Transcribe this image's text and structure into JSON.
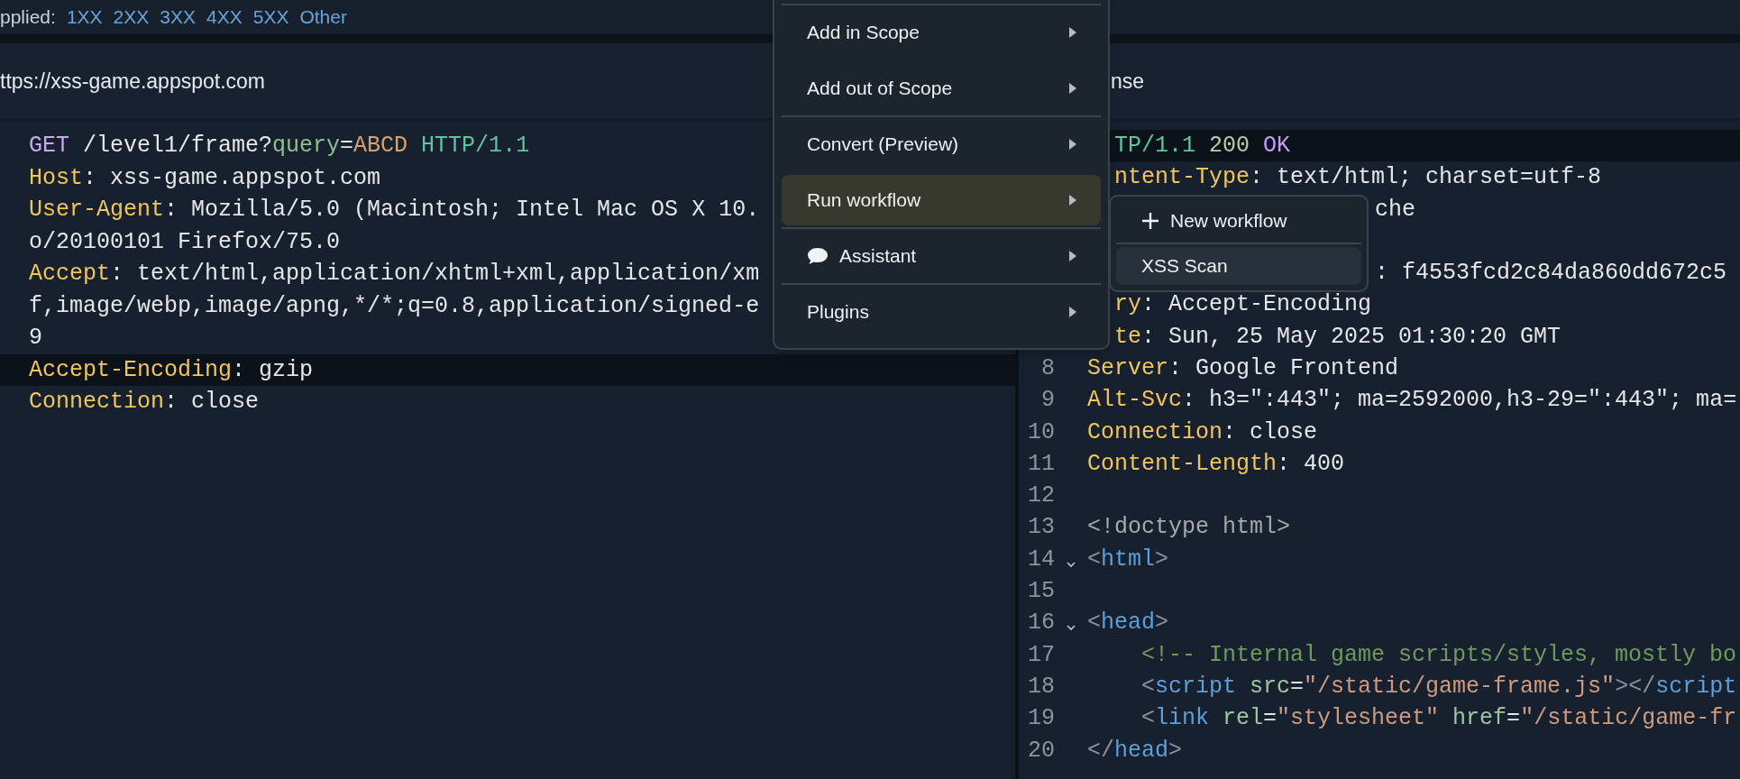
{
  "filter_bar": {
    "label": "pplied:",
    "options": [
      {
        "label": "1XX"
      },
      {
        "label": "2XX"
      },
      {
        "label": "3XX"
      },
      {
        "label": "4XX"
      },
      {
        "label": "5XX"
      },
      {
        "label": "Other"
      }
    ]
  },
  "request": {
    "title": "ttps://xss-game.appspot.com",
    "lines": [
      {
        "highlighted": false,
        "tokens": [
          {
            "text": "GET",
            "kind": "method"
          },
          {
            "text": " /level1/frame?",
            "kind": "plain"
          },
          {
            "text": "query",
            "kind": "param"
          },
          {
            "text": "=",
            "kind": "plain"
          },
          {
            "text": "ABCD",
            "kind": "value"
          },
          {
            "text": " HTTP/1.1",
            "kind": "version"
          }
        ]
      },
      {
        "highlighted": false,
        "tokens": [
          {
            "text": "Host",
            "kind": "key"
          },
          {
            "text": ": xss-game.appspot.com",
            "kind": "plain"
          }
        ]
      },
      {
        "highlighted": false,
        "tokens": [
          {
            "text": "User-Agent",
            "kind": "key"
          },
          {
            "text": ": Mozilla/5.0 (Macintosh; Intel Mac OS X 10.",
            "kind": "plain"
          }
        ]
      },
      {
        "highlighted": false,
        "tokens": [
          {
            "text": "o/20100101 Firefox/75.0",
            "kind": "plain"
          }
        ]
      },
      {
        "highlighted": false,
        "tokens": [
          {
            "text": "Accept",
            "kind": "key"
          },
          {
            "text": ": text/html,application/xhtml+xml,application/xm",
            "kind": "plain"
          }
        ]
      },
      {
        "highlighted": false,
        "tokens": [
          {
            "text": "f,image/webp,image/apng,*/*;q=0.8,application/signed-e",
            "kind": "plain"
          }
        ]
      },
      {
        "highlighted": false,
        "tokens": [
          {
            "text": "9",
            "kind": "plain"
          }
        ]
      },
      {
        "highlighted": true,
        "tokens": [
          {
            "text": "Accept-Encoding",
            "kind": "key"
          },
          {
            "text": ": gzip",
            "kind": "plain"
          }
        ]
      },
      {
        "highlighted": false,
        "tokens": [
          {
            "text": "Connection",
            "kind": "key"
          },
          {
            "text": ": close",
            "kind": "plain"
          }
        ]
      }
    ]
  },
  "response": {
    "title": "nse",
    "lines": [
      {
        "kind": "after_menu",
        "highlighted": true,
        "tokens": [
          {
            "text": "TP/1.1",
            "kind": "version"
          },
          {
            "text": " 200",
            "kind": "status"
          },
          {
            "text": " OK",
            "kind": "reason"
          }
        ]
      },
      {
        "kind": "after_menu",
        "highlighted": false,
        "tokens": [
          {
            "text": "ntent-Type",
            "kind": "key"
          },
          {
            "text": ": text/html; charset=utf-8",
            "kind": "plain"
          }
        ]
      },
      {
        "kind": "after_submenu",
        "highlighted": false,
        "tokens": [
          {
            "text": "che",
            "kind": "plain"
          }
        ]
      },
      {
        "kind": "covered",
        "highlighted": false
      },
      {
        "kind": "after_submenu",
        "highlighted": false,
        "tokens": [
          {
            "text": ": f4553fcd2c84da860dd672c5",
            "kind": "plain"
          }
        ]
      },
      {
        "kind": "after_menu",
        "highlighted": false,
        "tokens": [
          {
            "text": "ry",
            "kind": "key"
          },
          {
            "text": ": Accept-Encoding",
            "kind": "plain"
          }
        ]
      },
      {
        "kind": "after_menu",
        "highlighted": false,
        "tokens": [
          {
            "text": "te",
            "kind": "key"
          },
          {
            "text": ": Sun, 25 May 2025 01:30:20 GMT",
            "kind": "plain"
          }
        ]
      },
      {
        "kind": "full",
        "number": "8",
        "highlighted": false,
        "tokens": [
          {
            "text": "Server",
            "kind": "key"
          },
          {
            "text": ": Google Frontend",
            "kind": "plain"
          }
        ]
      },
      {
        "kind": "full",
        "number": "9",
        "highlighted": false,
        "tokens": [
          {
            "text": "Alt-Svc",
            "kind": "key"
          },
          {
            "text": ": h3=\":443\"; ma=2592000,h3-29=\":443\"; ma=",
            "kind": "plain"
          }
        ]
      },
      {
        "kind": "full",
        "number": "10",
        "highlighted": false,
        "tokens": [
          {
            "text": "Connection",
            "kind": "key"
          },
          {
            "text": ": close",
            "kind": "plain"
          }
        ]
      },
      {
        "kind": "full",
        "number": "11",
        "highlighted": false,
        "tokens": [
          {
            "text": "Content-Length",
            "kind": "key"
          },
          {
            "text": ": 400",
            "kind": "plain"
          }
        ]
      },
      {
        "kind": "full",
        "number": "12",
        "highlighted": false
      },
      {
        "kind": "full",
        "number": "13",
        "highlighted": false,
        "tokens": [
          {
            "text": "<!doctype html>",
            "kind": "doctype"
          }
        ]
      },
      {
        "kind": "full",
        "number": "14",
        "highlighted": false,
        "expanded": true,
        "tokens": [
          {
            "text": "<",
            "kind": "punct"
          },
          {
            "text": "html",
            "kind": "tag"
          },
          {
            "text": ">",
            "kind": "punct"
          }
        ]
      },
      {
        "kind": "full",
        "number": "15",
        "highlighted": false
      },
      {
        "kind": "full",
        "number": "16",
        "highlighted": false,
        "expanded": true,
        "tokens": [
          {
            "text": "<",
            "kind": "punct"
          },
          {
            "text": "head",
            "kind": "tag"
          },
          {
            "text": ">",
            "kind": "punct"
          }
        ]
      },
      {
        "kind": "full",
        "number": "17",
        "highlighted": false,
        "tokens": [
          {
            "text": "    <!-- Internal game scripts/styles, mostly bo",
            "kind": "comment"
          }
        ]
      },
      {
        "kind": "full",
        "number": "18",
        "highlighted": false,
        "tokens": [
          {
            "text": "    <",
            "kind": "punct"
          },
          {
            "text": "script",
            "kind": "tag"
          },
          {
            "text": " src",
            "kind": "attr"
          },
          {
            "text": "=",
            "kind": "plain"
          },
          {
            "text": "\"/static/game-frame.js\"",
            "kind": "string"
          },
          {
            "text": "></",
            "kind": "punct"
          },
          {
            "text": "script",
            "kind": "tag"
          }
        ]
      },
      {
        "kind": "full",
        "number": "19",
        "highlighted": false,
        "tokens": [
          {
            "text": "    <",
            "kind": "punct"
          },
          {
            "text": "link",
            "kind": "tag"
          },
          {
            "text": " rel",
            "kind": "attr"
          },
          {
            "text": "=",
            "kind": "plain"
          },
          {
            "text": "\"stylesheet\"",
            "kind": "string"
          },
          {
            "text": " href",
            "kind": "attr"
          },
          {
            "text": "=",
            "kind": "plain"
          },
          {
            "text": "\"/static/game-fr",
            "kind": "string"
          }
        ]
      },
      {
        "kind": "full",
        "number": "20",
        "highlighted": false,
        "tokens": [
          {
            "text": "</",
            "kind": "punct"
          },
          {
            "text": "head",
            "kind": "tag"
          },
          {
            "text": ">",
            "kind": "punct"
          }
        ]
      }
    ]
  },
  "context_menu": {
    "items": [
      {
        "label": "Add in Scope",
        "selected": false,
        "divider_after": false
      },
      {
        "label": "Add out of Scope",
        "selected": false,
        "divider_after": true
      },
      {
        "label": "Convert (Preview)",
        "selected": false,
        "divider_after": false
      },
      {
        "label": "Run workflow",
        "selected": true,
        "divider_after": true
      },
      {
        "label": "Assistant",
        "kind": "chat",
        "selected": false,
        "divider_after": true
      },
      {
        "label": "Plugins",
        "selected": false,
        "divider_after": false
      }
    ],
    "submenu": {
      "items": [
        {
          "label": "New workflow",
          "kind": "create",
          "selected": false
        },
        {
          "label": "XSS Scan",
          "selected": true
        }
      ]
    }
  }
}
